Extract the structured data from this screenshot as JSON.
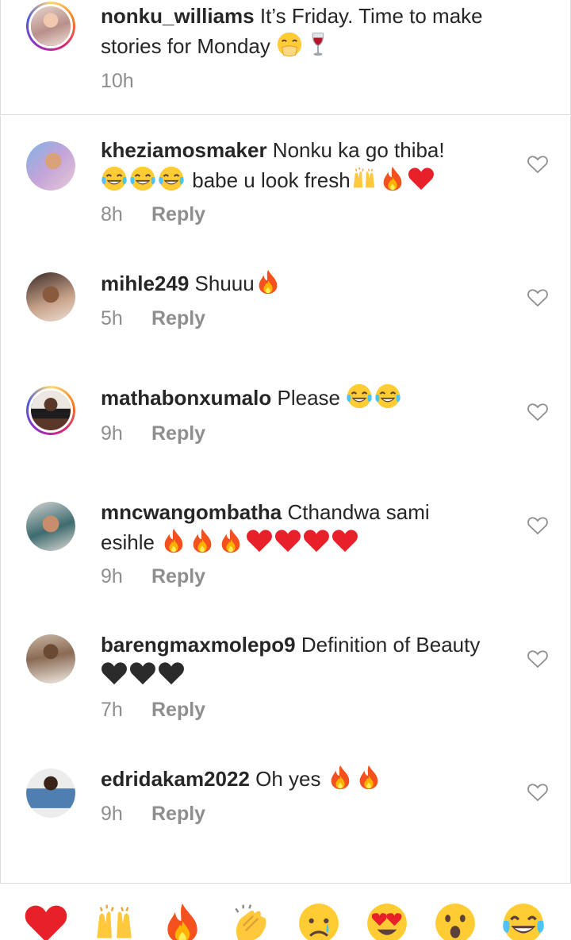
{
  "caption": {
    "username": "nonku_williams",
    "text": "It’s Friday. Time to make stories for Monday",
    "emojis": [
      "face-hand-over-mouth",
      "wine-glass"
    ],
    "time": "10h"
  },
  "comments": [
    {
      "username": "kheziamosmaker",
      "text": "Nonku ka go thiba!",
      "text2": "babe u look fresh",
      "emojis_before2": [
        "joy",
        "joy",
        "joy"
      ],
      "emojis_after2": [
        "raising-hands",
        "fire",
        "red-heart"
      ],
      "time": "8h",
      "reply": "Reply",
      "ring": false
    },
    {
      "username": "mihle249",
      "text": "Shuuu",
      "emojis_after": [
        "fire"
      ],
      "time": "5h",
      "reply": "Reply",
      "ring": false
    },
    {
      "username": "mathabonxumalo",
      "text": "Please",
      "emojis_after": [
        "joy",
        "joy"
      ],
      "time": "9h",
      "reply": "Reply",
      "ring": true
    },
    {
      "username": "mncwangombatha",
      "text": "Cthandwa sami",
      "text2": "esihle",
      "emojis_after2": [
        "fire",
        "fire",
        "fire",
        "red-heart",
        "red-heart",
        "red-heart",
        "red-heart"
      ],
      "time": "9h",
      "reply": "Reply",
      "ring": false
    },
    {
      "username": "barengmaxmolepo9",
      "text": "Definition of Beauty",
      "emojis_line2": [
        "black-heart",
        "black-heart",
        "black-heart"
      ],
      "time": "7h",
      "reply": "Reply",
      "ring": false
    },
    {
      "username": "edridakam2022",
      "text": "Oh yes",
      "emojis_after": [
        "fire",
        "fire"
      ],
      "time": "9h",
      "reply": "Reply",
      "ring": false
    }
  ],
  "reaction_tray": [
    "red-heart",
    "raising-hands",
    "fire",
    "clapping-hands",
    "crying-face",
    "heart-eyes",
    "astonished",
    "joy"
  ],
  "colors": {
    "text": "#262626",
    "meta": "#8e8e8e",
    "divider": "#dbdbdb",
    "heart": "#e8202a",
    "fire": "#f7881f"
  }
}
